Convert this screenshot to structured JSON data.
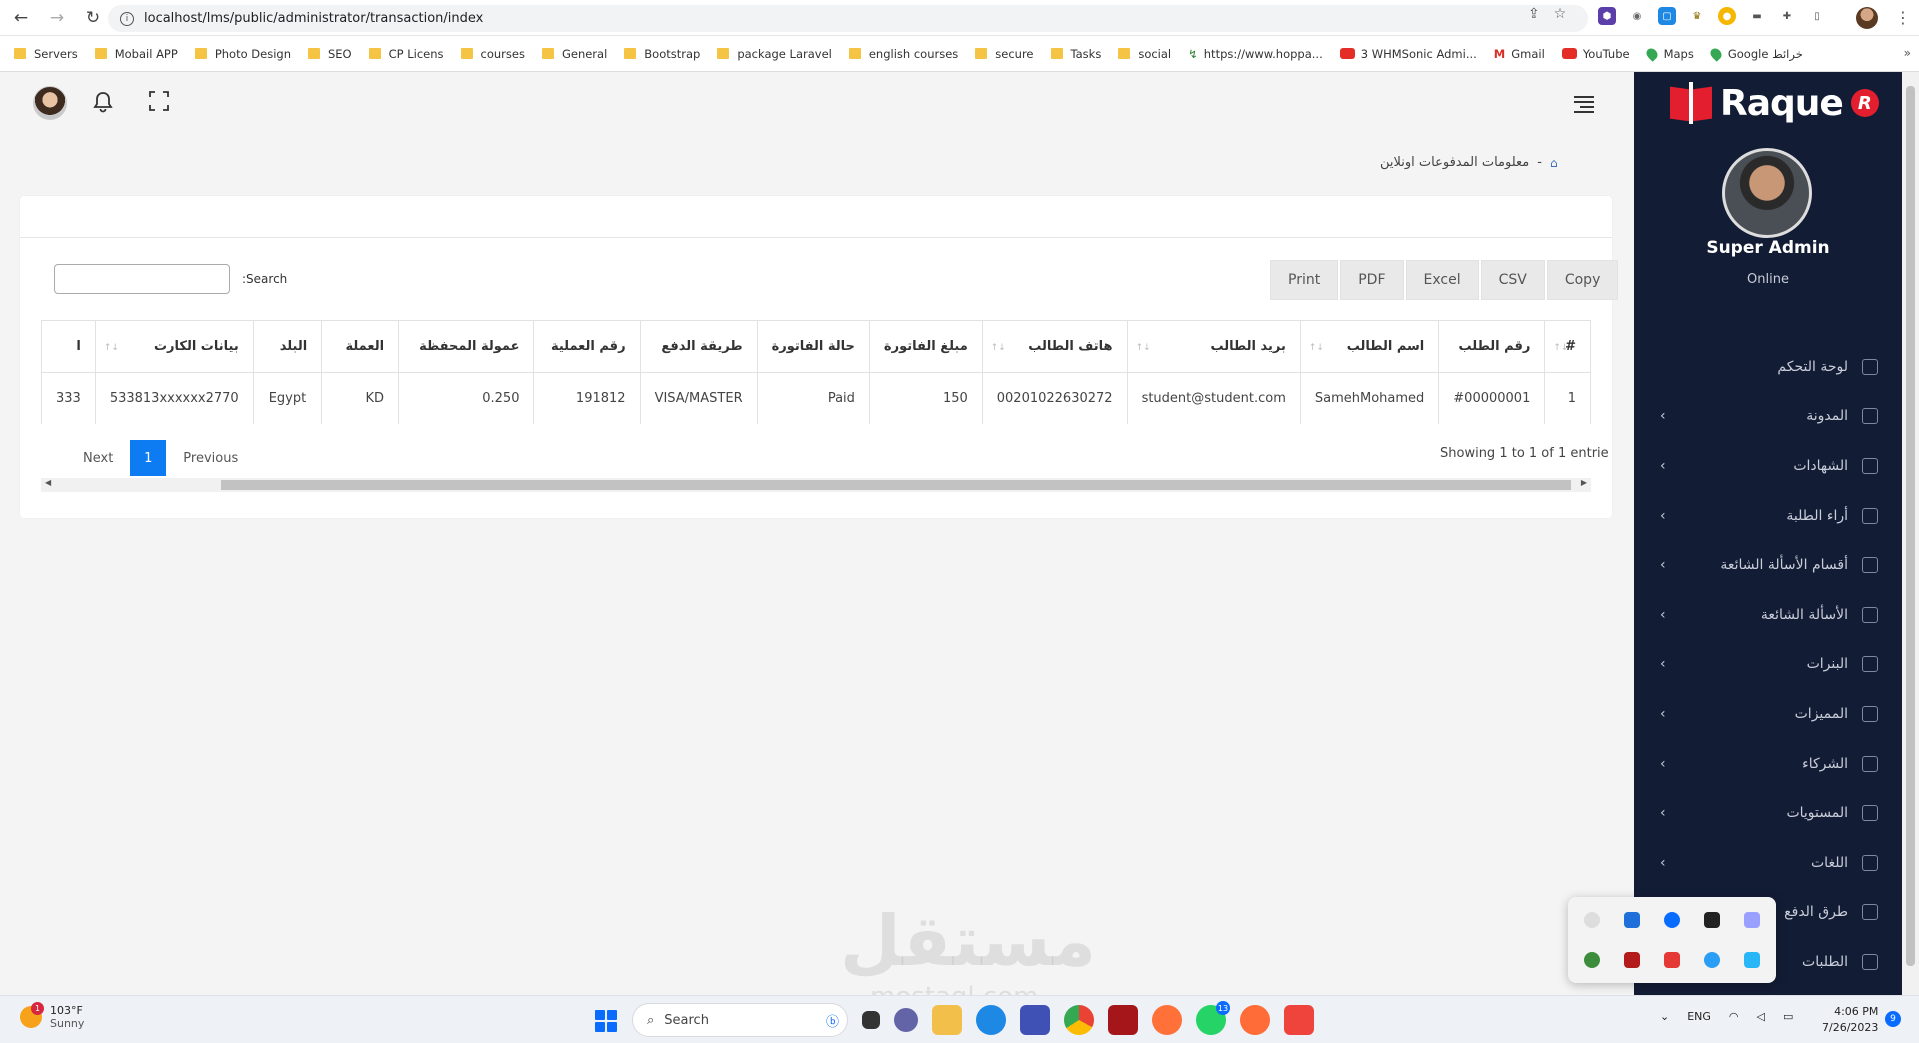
{
  "browser": {
    "url": "localhost/lms/public/administrator/transaction/index",
    "bookmarks": [
      {
        "label": "Servers",
        "type": "folder"
      },
      {
        "label": "Mobail APP",
        "type": "folder"
      },
      {
        "label": "Photo Design",
        "type": "folder"
      },
      {
        "label": "SEO",
        "type": "folder"
      },
      {
        "label": "CP Licens",
        "type": "folder"
      },
      {
        "label": "courses",
        "type": "folder"
      },
      {
        "label": "General",
        "type": "folder"
      },
      {
        "label": "Bootstrap",
        "type": "folder"
      },
      {
        "label": "package Laravel",
        "type": "folder"
      },
      {
        "label": "english courses",
        "type": "folder"
      },
      {
        "label": "secure",
        "type": "folder"
      },
      {
        "label": "Tasks",
        "type": "folder"
      },
      {
        "label": "social",
        "type": "folder"
      },
      {
        "label": "https://www.hoppa...",
        "type": "link"
      },
      {
        "label": "3 WHMSonic Admi...",
        "type": "yt"
      },
      {
        "label": "Gmail",
        "type": "gmail"
      },
      {
        "label": "YouTube",
        "type": "yt"
      },
      {
        "label": "Maps",
        "type": "maps"
      },
      {
        "label": "Google خرائط",
        "type": "maps"
      }
    ],
    "more": "»"
  },
  "breadcrumb": {
    "current": "معلومات المدفوعات اونلاين",
    "separator": "-"
  },
  "toolbar": {
    "buttons": [
      "Print",
      "PDF",
      "Excel",
      "CSV",
      "Copy"
    ],
    "search_label": ":Search",
    "search_value": ""
  },
  "table": {
    "headers": [
      "ا",
      "بيانات الكارت",
      "البلد",
      "العملة",
      "عمولة المحفظة",
      "رقم العملية",
      "طريقة الدفع",
      "حالة الفاتورة",
      "مبلغ الفاتورة",
      "هاتف الطالب",
      "بريد الطالب",
      "اسم الطالب",
      "رقم الطلب",
      "#"
    ],
    "rows": [
      [
        "333",
        "533813xxxxxx2770",
        "Egypt",
        "KD",
        "0.250",
        "191812",
        "VISA/MASTER",
        "Paid",
        "150",
        "00201022630272",
        "student@student.com",
        "SamehMohamed",
        "#00000001",
        "1"
      ]
    ]
  },
  "pagination": {
    "next": "Next",
    "page": "1",
    "previous": "Previous",
    "showing": "Showing 1 to 1 of 1 entrie"
  },
  "sidebar": {
    "brand": "Raque",
    "brand_mark": "R",
    "user_name": "Super Admin",
    "status": "Online",
    "items": [
      {
        "label": "لوحة التحكم",
        "chevron": false
      },
      {
        "label": "المدونة",
        "chevron": true
      },
      {
        "label": "الشهادات",
        "chevron": true
      },
      {
        "label": "أراء الطلبة",
        "chevron": true
      },
      {
        "label": "أقسام الأسألة الشائعة",
        "chevron": true
      },
      {
        "label": "الأسألة الشائعة",
        "chevron": true
      },
      {
        "label": "البنرات",
        "chevron": true
      },
      {
        "label": "المميزات",
        "chevron": true
      },
      {
        "label": "الشركاء",
        "chevron": true
      },
      {
        "label": "المستويات",
        "chevron": true
      },
      {
        "label": "اللغات",
        "chevron": true
      },
      {
        "label": "طرق الدفع",
        "chevron": true
      },
      {
        "label": "الطلبات",
        "chevron": true
      }
    ]
  },
  "watermark": {
    "text": "مستقل",
    "sub": "mostaql.com"
  },
  "taskbar": {
    "temp": "103°F",
    "weather": "Sunny",
    "weather_badge": "1",
    "search_placeholder": "Search",
    "whatsapp_badge": "13",
    "lang": "ENG",
    "time": "4:06 PM",
    "date": "7/26/2023",
    "notif_count": "9"
  }
}
